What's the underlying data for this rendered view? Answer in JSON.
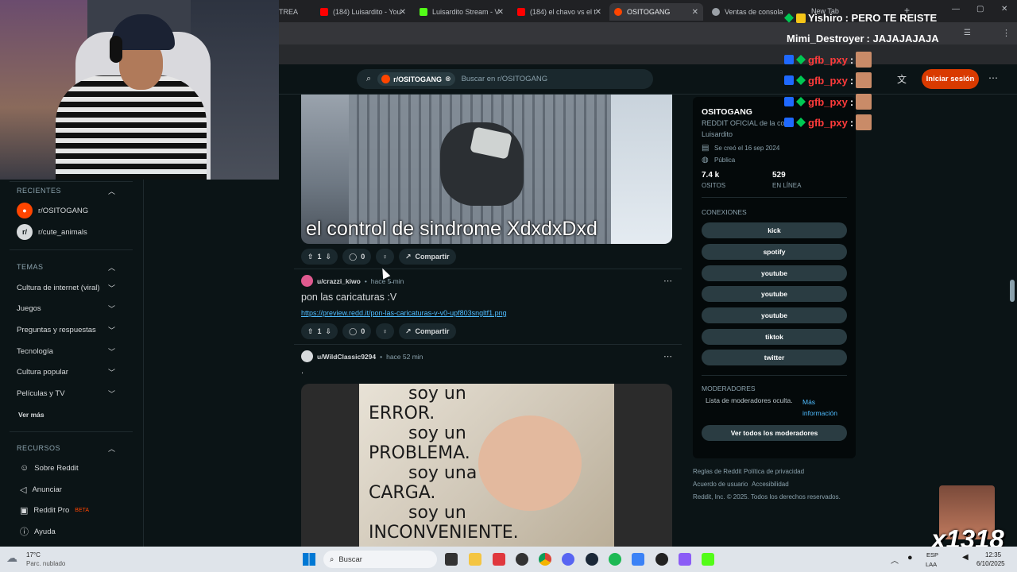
{
  "tabs": [
    {
      "title": "TREA",
      "color": "#9aa0a6"
    },
    {
      "title": "(184) Luisardito - You",
      "color": "#ff0000"
    },
    {
      "title": "Luisardito Stream - V",
      "color": "#53fc18"
    },
    {
      "title": "(184) el chavo vs el t",
      "color": "#ff0000"
    },
    {
      "title": "OSITOGANG",
      "color": "#ff4500"
    },
    {
      "title": "Ventas de consolas",
      "color": "#9aa0a6"
    },
    {
      "title": "New Tab",
      "color": "#9aa0a6"
    }
  ],
  "header": {
    "search_chip": "r/OSITOGANG",
    "search_placeholder": "Buscar en r/OSITOGANG",
    "login_label": "Iniciar sesión"
  },
  "sidebar": {
    "recent_title": "RECIENTES",
    "recent": [
      {
        "label": "r/OSITOGANG"
      },
      {
        "label": "r/cute_animals"
      }
    ],
    "topics_title": "TEMAS",
    "topics": [
      {
        "label": "Cultura de internet (viral)"
      },
      {
        "label": "Juegos"
      },
      {
        "label": "Preguntas y respuestas"
      },
      {
        "label": "Tecnología"
      },
      {
        "label": "Cultura popular"
      },
      {
        "label": "Películas y TV"
      }
    ],
    "see_more": "Ver más",
    "resources_title": "RECURSOS",
    "resources": [
      {
        "label": "Sobre Reddit"
      },
      {
        "label": "Anunciar"
      },
      {
        "label": "Reddit Pro",
        "badge": "BETA"
      },
      {
        "label": "Ayuda"
      }
    ]
  },
  "posts": [
    {
      "caption": "el control de sindrome XdxdxDxd",
      "votes": "1",
      "comments": "0",
      "share": "Compartir"
    },
    {
      "user": "u/crazzi_kiwo",
      "time": "hace 5̶ min",
      "title": "pon las caricaturas :V",
      "link": "https://preview.redd.it/pon-las-caricaturas-v-v0-upf803sngltf1.png",
      "votes": "1",
      "comments": "0",
      "share": "Compartir"
    },
    {
      "user": "u/WildClassic9294",
      "time": "hace 52 min",
      "body": ".",
      "meme_lines": [
        "soy un",
        "ERROR.",
        "soy un",
        "PROBLEMA.",
        "soy una",
        "CARGA.",
        "soy un",
        "INCONVENIENTE."
      ]
    }
  ],
  "community": {
    "name": "OSITOGANG",
    "desc": "REDDIT OFICIAL de la co",
    "owner": "Luisardito",
    "created": "Se creó el 16 sep 2024",
    "visibility": "Pública",
    "members": "7.4 k",
    "members_label": "OSITOS",
    "online": "529",
    "online_label": "EN LÍNEA",
    "connections_title": "CONEXIONES",
    "connections": [
      "kick",
      "spotify",
      "youtube",
      "youtube",
      "youtube",
      "tiktok",
      "twitter"
    ],
    "mods_title": "MODERADORES",
    "mods_hidden": "Lista de moderadores oculta.",
    "mods_more": "Más información",
    "mods_button": "Ver todos los moderadores"
  },
  "footer": {
    "rules": "Reglas de Reddit",
    "privacy": "Política de privacidad",
    "user_agreement": "Acuerdo de usuario",
    "accessibility": "Accesibilidad",
    "copyright": "Reddit, Inc. © 2025. Todos los derechos reservados."
  },
  "chat": [
    {
      "name": "Yishiro",
      "msg": ": PERO TE REISTE",
      "name_color": "#ffffff"
    },
    {
      "name": "Mimi_Destroyer",
      "msg": ": JAJAJAJAJA",
      "name_color": "#ffffff"
    },
    {
      "name": "gfb_pxy",
      "msg": ":"
    },
    {
      "name": "gfb_pxy",
      "msg": ":"
    },
    {
      "name": "gfb_pxy",
      "msg": ":"
    },
    {
      "name": "gfb_pxy",
      "msg": ":"
    }
  ],
  "overlay_counter": "x1318",
  "taskbar": {
    "weather_temp": "17°C",
    "weather_desc": "Parc. nublado",
    "search_label": "Buscar",
    "lang": "ESP",
    "lang2": "LAA",
    "time": "12:35",
    "date": "6/10/2025"
  }
}
